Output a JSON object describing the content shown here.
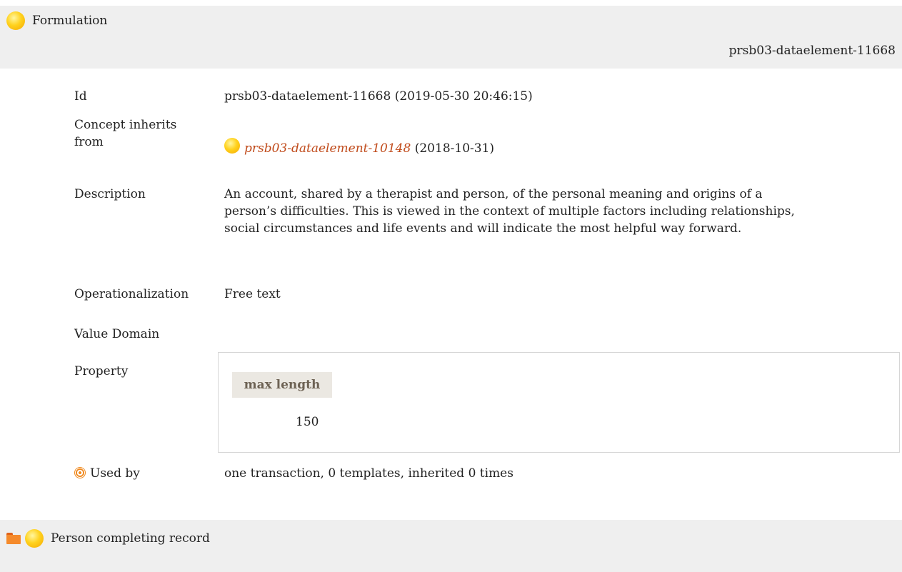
{
  "header": {
    "title": "Formulation",
    "id": "prsb03-dataelement-11668"
  },
  "rows": {
    "id": {
      "label": "Id",
      "value": "prsb03-dataelement-11668 (2019-05-30 20:46:15)"
    },
    "inherits": {
      "label": "Concept inherits from",
      "link": "prsb03-dataelement-10148",
      "date": "(2018-10-31)"
    },
    "description": {
      "label": "Description",
      "value": "An account, shared by a therapist and person, of the personal meaning and origins of a person’s difficulties. This is viewed in the context of multiple factors including relationships, social circumstances and life events and will indicate the most helpful way forward."
    },
    "operationalization": {
      "label": "Operationalization",
      "value": "Free text"
    },
    "value_domain": {
      "label": "Value Domain"
    },
    "property": {
      "label": "Property",
      "header": "max length",
      "value": "150"
    },
    "used_by": {
      "label": "Used by",
      "value": "one transaction, 0 templates, inherited 0 times"
    }
  },
  "footer": {
    "title": "Person completing record"
  },
  "colors": {
    "bar_bg": "#efefef",
    "link": "#c04a1a",
    "prop_header_bg": "#ebe8e2",
    "accent_orange": "#f08a20"
  },
  "icons": [
    "concept-bulb-icon",
    "target-icon",
    "folder-open-icon"
  ]
}
